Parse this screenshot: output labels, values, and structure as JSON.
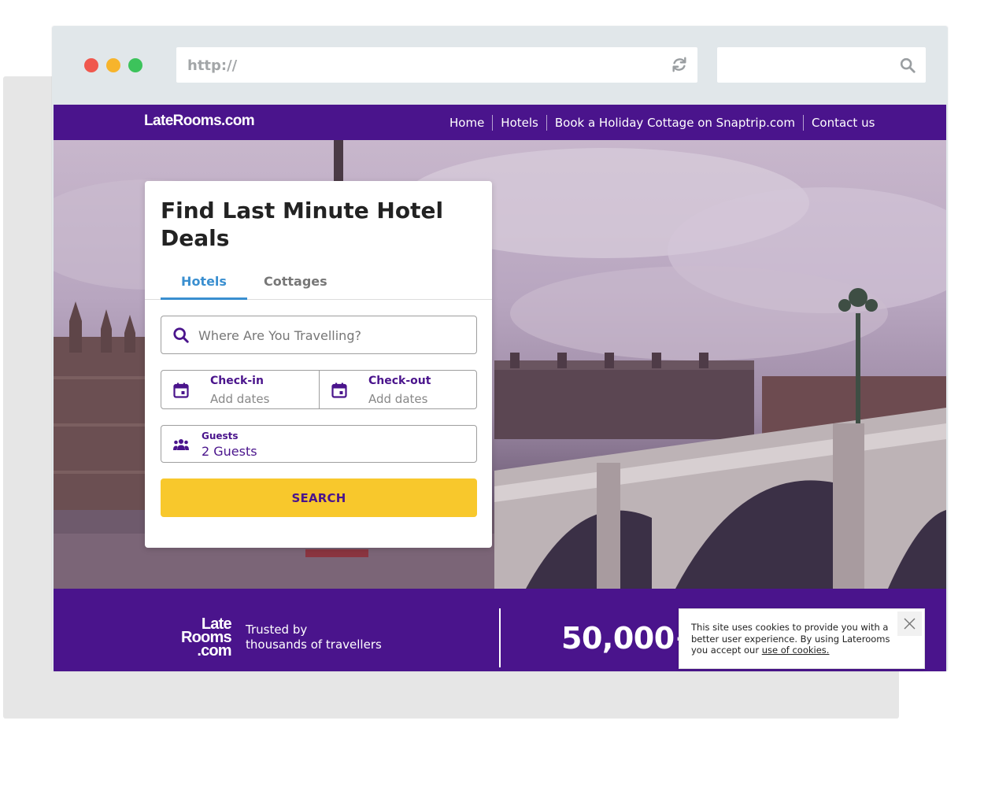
{
  "browser": {
    "url_text": "http://",
    "icons": [
      "refresh-icon",
      "search-icon"
    ]
  },
  "site": {
    "logo": "LateRooms.com",
    "nav": [
      {
        "label": "Home"
      },
      {
        "label": "Hotels"
      },
      {
        "label": "Book a Holiday Cottage on Snaptrip.com"
      },
      {
        "label": "Contact us"
      }
    ]
  },
  "search_card": {
    "title": "Find Last Minute Hotel Deals",
    "tabs": [
      {
        "label": "Hotels",
        "active": true
      },
      {
        "label": "Cottages",
        "active": false
      }
    ],
    "destination_placeholder": "Where Are You Travelling?",
    "checkin_label": "Check-in",
    "checkin_value": "Add dates",
    "checkout_label": "Check-out",
    "checkout_value": "Add dates",
    "guests_label": "Guests",
    "guests_value": "2 Guests",
    "search_button": "SEARCH"
  },
  "trust": {
    "logo_lines": [
      "Late",
      "Rooms",
      ".com"
    ],
    "text_line1": "Trusted by",
    "text_line2": "thousands of travellers",
    "big_number": "50,000+"
  },
  "cookie": {
    "text": "This site uses cookies to provide you with a better user experience. By using Laterooms you accept our ",
    "link": "use of cookies."
  },
  "colors": {
    "brand_purple": "#4a148c",
    "accent_yellow": "#f8c82c",
    "tab_blue": "#3a8fd0"
  }
}
